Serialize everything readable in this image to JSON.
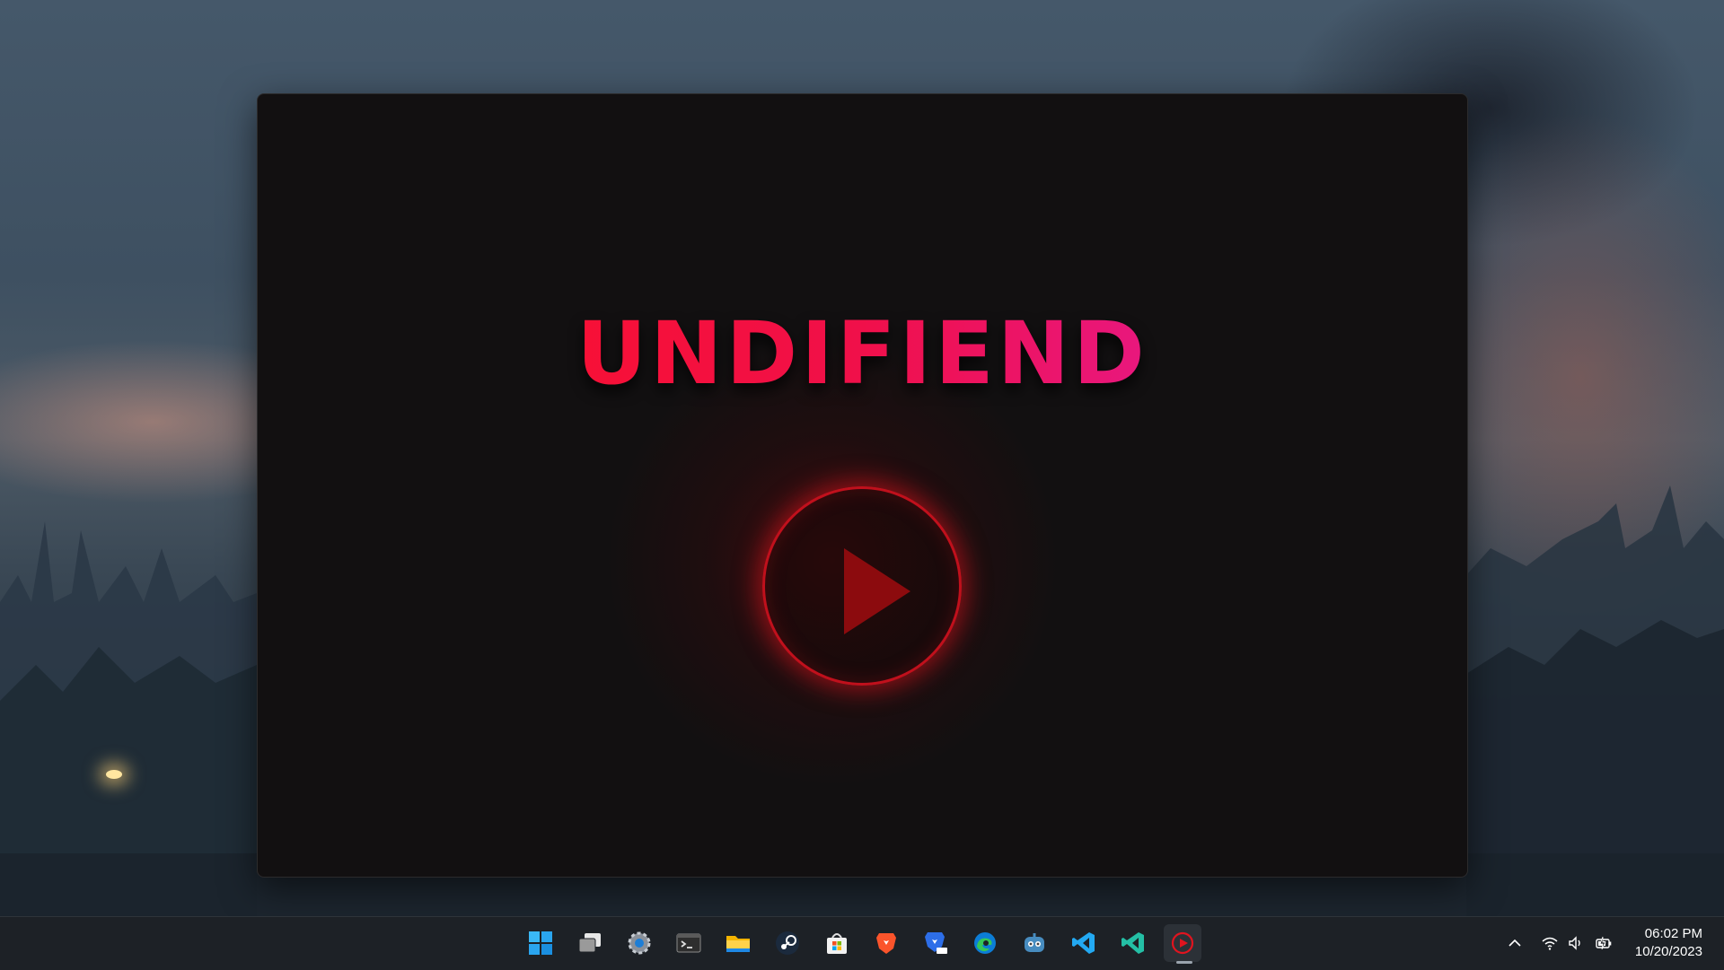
{
  "app": {
    "title": "UNDIFIEND",
    "play_icon": "play-icon",
    "accent_color": "#ff1020",
    "gradient_end_color": "#e020b8"
  },
  "taskbar": {
    "apps": [
      {
        "name": "Start",
        "icon": "windows-logo-icon"
      },
      {
        "name": "Task View",
        "icon": "task-view-icon"
      },
      {
        "name": "Settings",
        "icon": "gear-icon"
      },
      {
        "name": "Terminal",
        "icon": "terminal-icon"
      },
      {
        "name": "File Explorer",
        "icon": "folder-icon"
      },
      {
        "name": "Steam",
        "icon": "steam-icon"
      },
      {
        "name": "Microsoft Store",
        "icon": "store-icon"
      },
      {
        "name": "Brave",
        "icon": "brave-icon"
      },
      {
        "name": "Brave Beta",
        "icon": "brave-beta-icon"
      },
      {
        "name": "Microsoft Edge",
        "icon": "edge-icon"
      },
      {
        "name": "Godot",
        "icon": "godot-icon"
      },
      {
        "name": "Visual Studio Code",
        "icon": "vscode-icon"
      },
      {
        "name": "Visual Studio Code Insiders",
        "icon": "vscode-insiders-icon"
      },
      {
        "name": "Undifiend",
        "icon": "undifiend-play-icon",
        "active": true
      }
    ],
    "tray": {
      "overflow_icon": "chevron-up-icon",
      "wifi_icon": "wifi-icon",
      "volume_icon": "speaker-icon",
      "battery_icon": "battery-charging-icon"
    },
    "clock": {
      "time": "06:02 PM",
      "date": "10/20/2023"
    }
  }
}
